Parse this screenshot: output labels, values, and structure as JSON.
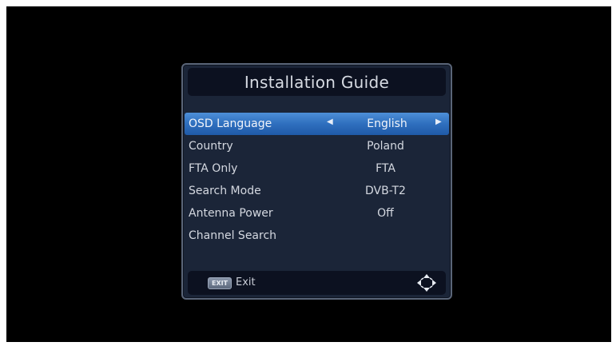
{
  "dialog": {
    "title": "Installation Guide"
  },
  "rows": [
    {
      "label": "OSD Language",
      "value": "English",
      "selected": true
    },
    {
      "label": "Country",
      "value": "Poland"
    },
    {
      "label": "FTA Only",
      "value": "FTA"
    },
    {
      "label": "Search Mode",
      "value": "DVB-T2"
    },
    {
      "label": "Antenna Power",
      "value": "Off"
    },
    {
      "label": "Channel Search",
      "value": ""
    }
  ],
  "footer": {
    "exit_key": "EXIT",
    "exit_label": "Exit",
    "nav_icon": "navigation-arrows-icon"
  },
  "colors": {
    "background": "#000000",
    "panel": "#1b2538",
    "highlight": "#2f6fbe"
  }
}
